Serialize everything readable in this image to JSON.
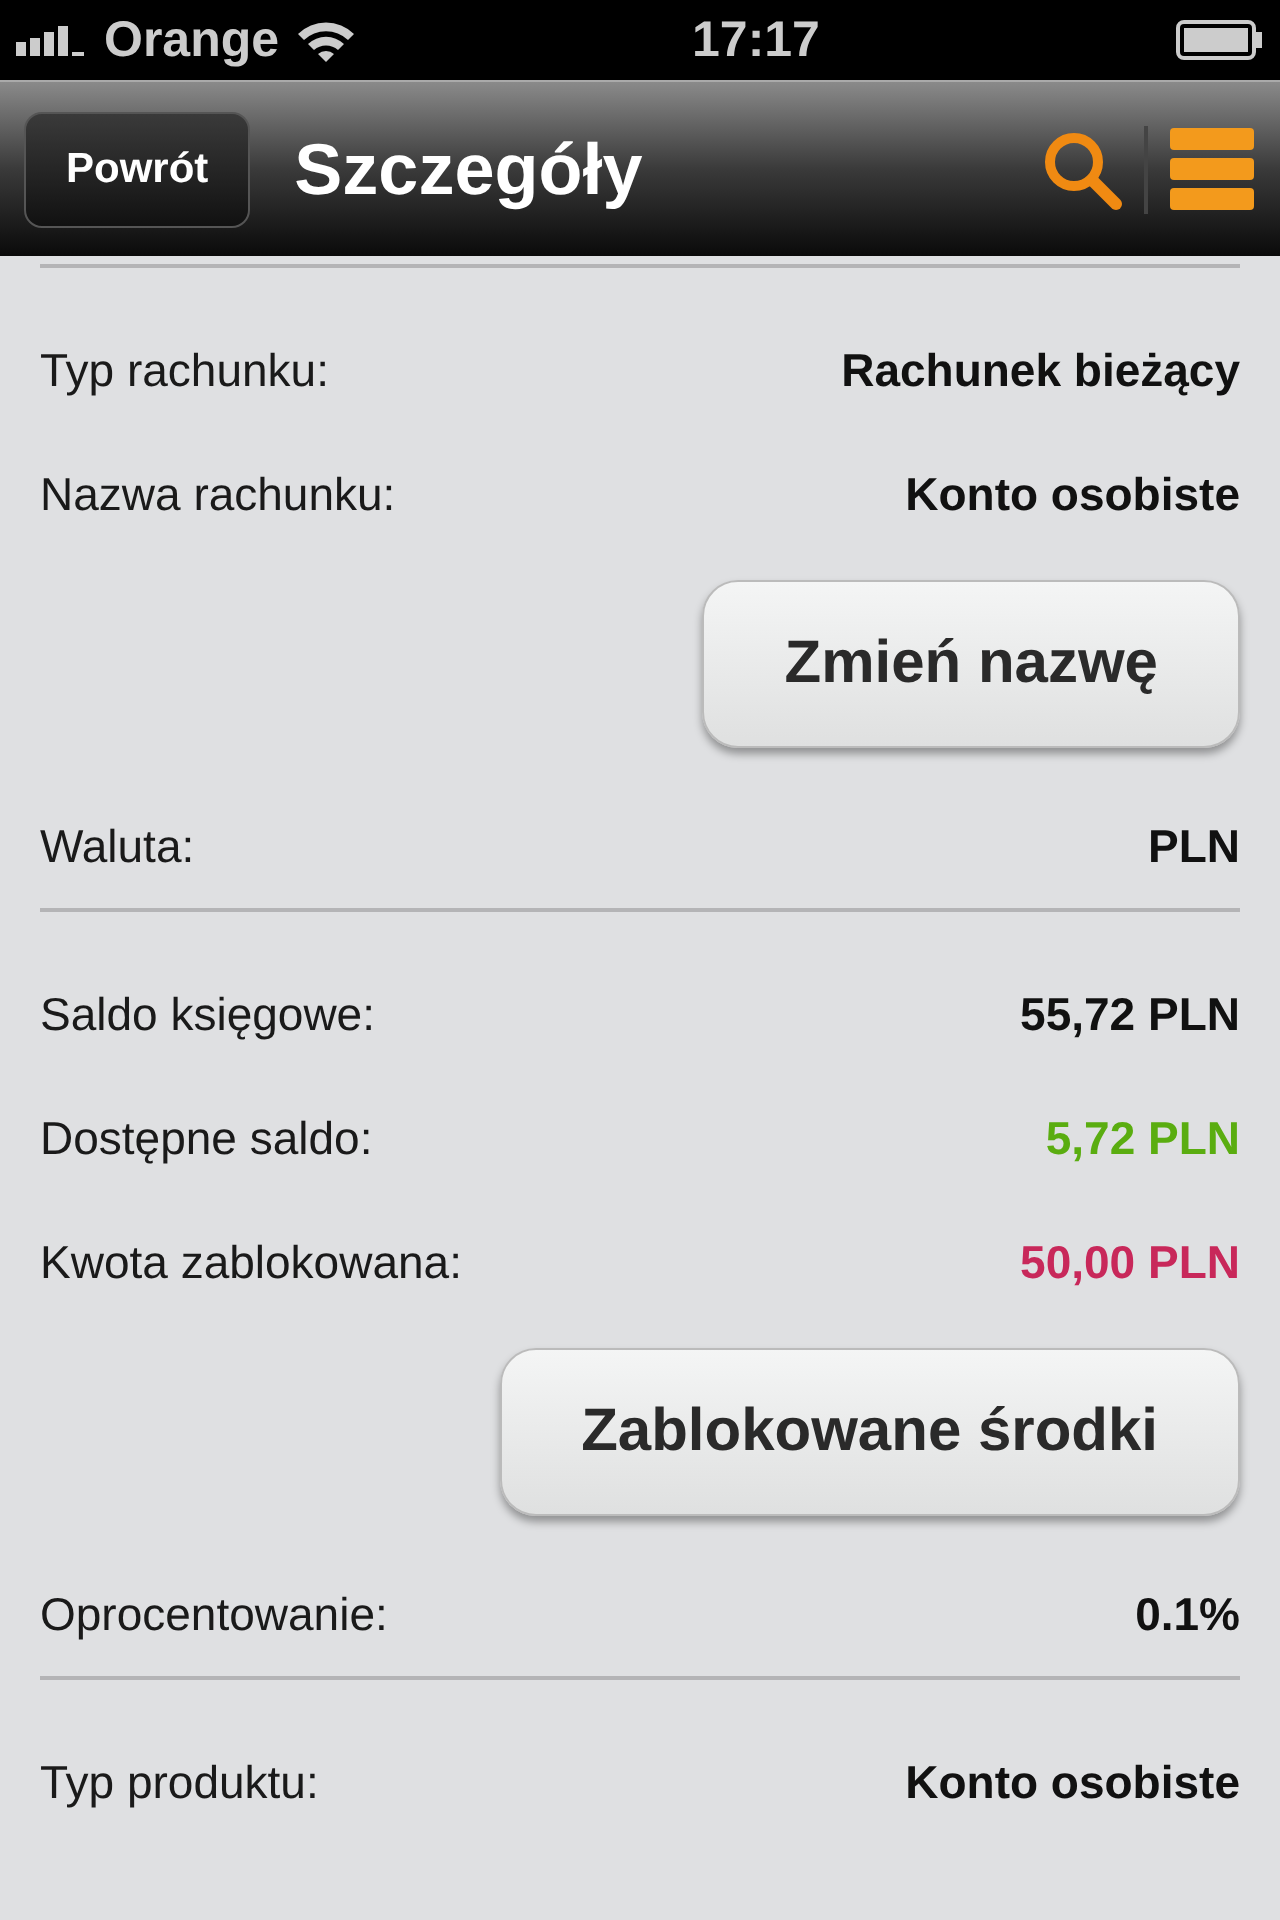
{
  "status_bar": {
    "carrier": "Orange",
    "time": "17:17"
  },
  "nav_bar": {
    "back": "Powrót",
    "title": "Szczegóły"
  },
  "sections": [
    {
      "items": [
        {
          "kind": "row",
          "label": "Typ rachunku:",
          "value": "Rachunek bieżący"
        },
        {
          "kind": "row",
          "label": "Nazwa rachunku:",
          "value": "Konto osobiste"
        },
        {
          "kind": "button",
          "label": "Zmień nazwę"
        },
        {
          "kind": "row",
          "label": "Waluta:",
          "value": "PLN"
        }
      ]
    },
    {
      "items": [
        {
          "kind": "row",
          "label": "Saldo księgowe:",
          "value": "55,72 PLN"
        },
        {
          "kind": "row",
          "label": "Dostępne saldo:",
          "value": "5,72 PLN",
          "color": "#5aad10"
        },
        {
          "kind": "row",
          "label": "Kwota zablokowana:",
          "value": "50,00 PLN",
          "color": "#c8285a"
        },
        {
          "kind": "button",
          "label": "Zablokowane środki"
        },
        {
          "kind": "row",
          "label": "Oprocentowanie:",
          "value": "0.1%"
        }
      ]
    },
    {
      "items": [
        {
          "kind": "row",
          "label": "Typ produktu:",
          "value": "Konto osobiste"
        }
      ]
    }
  ]
}
